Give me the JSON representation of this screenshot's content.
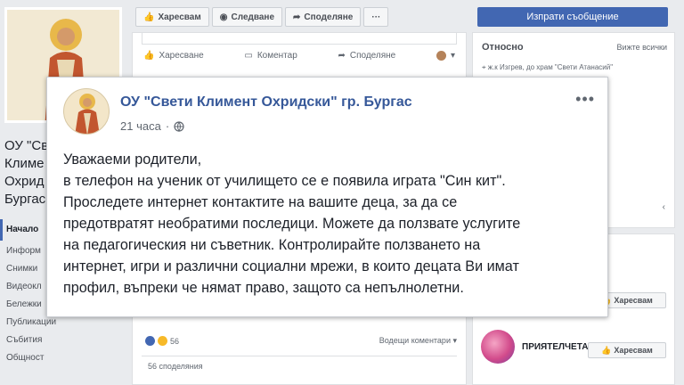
{
  "page": {
    "name_lines": [
      "ОУ \"Св",
      "Климе",
      "Охрид",
      "Бургас"
    ]
  },
  "nav": {
    "items": [
      "Начало",
      "Информ",
      "Снимки",
      "Видеокл",
      "Бележки",
      "Публикации",
      "Събития",
      "Общност"
    ]
  },
  "page_actions": {
    "like": "Харесвам",
    "follow": "Следване",
    "share": "Споделяне",
    "more": "···",
    "send_message": "Изпрати съобщение"
  },
  "feed": {
    "like_action": "Харесване",
    "comment_action": "Коментар",
    "share_action": "Споделяне",
    "reactions_count": "56",
    "comments_order": "Водещи коментари ▾",
    "shares": "56 споделяния"
  },
  "about": {
    "heading": "Относно",
    "see_all": "Вижте всички",
    "address": "ж.к Изгрев, до храм \"Свети Атанасий\"",
    "chevron": "‹"
  },
  "sidebar_likes": {
    "like_label": "Харесвам",
    "suggestion_name": "ПРИЯТЕЛЧЕТА..."
  },
  "post": {
    "author": "ОУ \"Свети Климент Охридски\" гр. Бургас",
    "time": "21 часа",
    "separator": "·",
    "more": "•••",
    "body_lines": [
      "Уважаеми родители,",
      "в телефон на ученик от училището се е появила играта \"Син кит\".",
      "Проследете интернет контактите на вашите деца, за да се",
      "предотвратят необратими последици. Можете да ползвате услугите",
      "на педагогическия ни съветник. Контролирайте ползването на",
      "интернет, игри и различни социални мрежи, в които децата Ви имат",
      "профил, въпреки че нямат право, защото са непълнолетни."
    ]
  },
  "colors": {
    "facebook_blue": "#4267b2",
    "link_blue": "#365899",
    "background": "#e9ebee"
  },
  "icons": [
    "thumbs-up-icon",
    "rss-icon",
    "share-arrow-icon",
    "comment-icon",
    "globe-icon",
    "location-pin-icon",
    "haha-reaction-icon",
    "like-reaction-icon"
  ]
}
